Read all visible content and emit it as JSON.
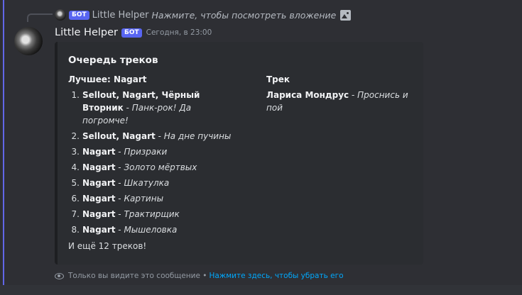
{
  "reply": {
    "author": "Little Helper",
    "badge": "БОТ",
    "preview": "Нажмите, чтобы посмотреть вложение"
  },
  "message": {
    "author": "Little Helper",
    "badge": "БОТ",
    "timestamp": "Сегодня, в 23:00"
  },
  "embed": {
    "title": "Очередь треков",
    "left_field": {
      "name": "Лучшее: Nagart",
      "tracks": [
        {
          "num": "1.",
          "artist": "Sellout, Nagart, Чёрный Вторник",
          "sep": " - ",
          "song": "Панк-рок! Да погромче!"
        },
        {
          "num": "2.",
          "artist": "Sellout, Nagart",
          "sep": " - ",
          "song": "На дне пучины"
        },
        {
          "num": "3.",
          "artist": "Nagart",
          "sep": " - ",
          "song": "Призраки"
        },
        {
          "num": "4.",
          "artist": "Nagart",
          "sep": " - ",
          "song": "Золото мёртвых"
        },
        {
          "num": "5.",
          "artist": "Nagart",
          "sep": " - ",
          "song": "Шкатулка"
        },
        {
          "num": "6.",
          "artist": "Nagart",
          "sep": " - ",
          "song": "Картины"
        },
        {
          "num": "7.",
          "artist": "Nagart",
          "sep": " - ",
          "song": "Трактирщик"
        },
        {
          "num": "8.",
          "artist": "Nagart",
          "sep": " - ",
          "song": "Мышеловка"
        }
      ]
    },
    "right_field": {
      "name": "Трек",
      "artist": "Лариса Мондрус",
      "sep": " - ",
      "song": "Проснись и пой"
    },
    "footer": "И ещё 12 треков!"
  },
  "ephemeral": {
    "text": "Только вы видите это сообщение •",
    "link": "Нажмите здесь, чтобы убрать его"
  },
  "colors": {
    "accent": "#5865f2",
    "link": "#00a8fc",
    "background": "#313338"
  }
}
